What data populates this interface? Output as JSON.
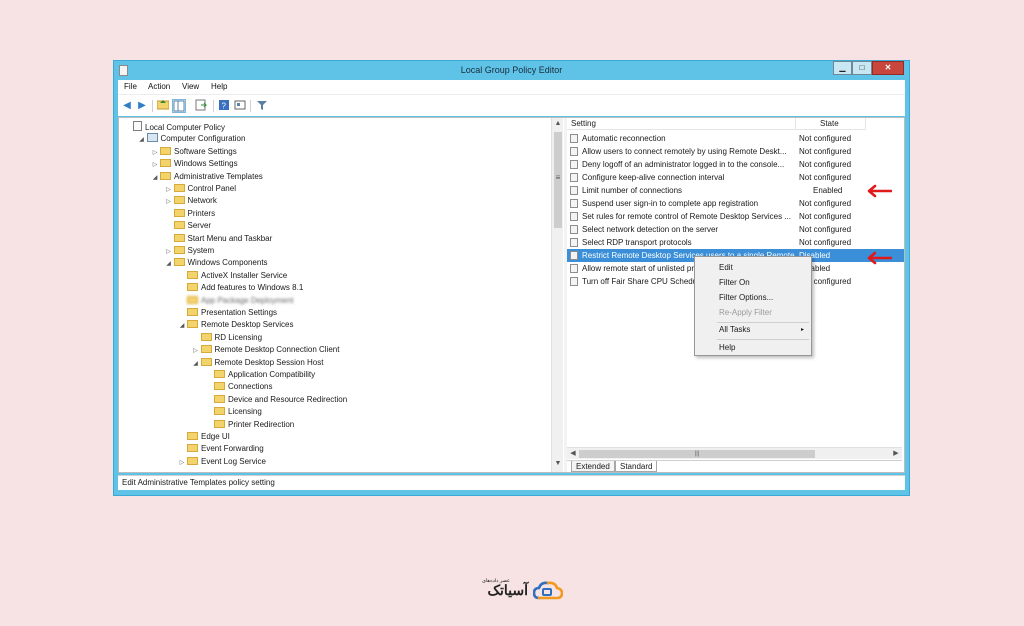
{
  "window": {
    "title": "Local Group Policy Editor",
    "controls": {
      "minimize": "▁",
      "maximize": "□",
      "close": "✕"
    }
  },
  "menu": [
    "File",
    "Action",
    "View",
    "Help"
  ],
  "toolbar": {
    "icons": [
      "back-arrow-icon",
      "forward-arrow-icon",
      "up-folder-icon",
      "show-hide-tree-icon",
      "export-list-icon",
      "help-icon",
      "properties-icon",
      "filter-icon"
    ]
  },
  "tree": [
    {
      "label": "Local Computer Policy",
      "icon": "doc",
      "expander": ""
    },
    {
      "label": "Computer Configuration",
      "icon": "pc",
      "expander": "◢"
    },
    {
      "label": "Software Settings",
      "icon": "folder",
      "expander": "▷"
    },
    {
      "label": "Windows Settings",
      "icon": "folder",
      "expander": "▷"
    },
    {
      "label": "Administrative Templates",
      "icon": "folder",
      "expander": "◢"
    },
    {
      "label": "Control Panel",
      "icon": "folder",
      "expander": "▷"
    },
    {
      "label": "Network",
      "icon": "folder",
      "expander": "▷"
    },
    {
      "label": "Printers",
      "icon": "folder",
      "expander": ""
    },
    {
      "label": "Server",
      "icon": "folder",
      "expander": ""
    },
    {
      "label": "Start Menu and Taskbar",
      "icon": "folder",
      "expander": ""
    },
    {
      "label": "System",
      "icon": "folder",
      "expander": "▷"
    },
    {
      "label": "Windows Components",
      "icon": "folder",
      "expander": "◢"
    },
    {
      "label": "ActiveX Installer Service",
      "icon": "folder",
      "expander": ""
    },
    {
      "label": "Add features to Windows 8.1",
      "icon": "folder",
      "expander": ""
    },
    {
      "label": "App Package Deployment",
      "icon": "folder",
      "expander": ""
    },
    {
      "label": "Presentation Settings",
      "icon": "folder",
      "expander": ""
    },
    {
      "label": "Remote Desktop Services",
      "icon": "folder",
      "expander": "◢"
    },
    {
      "label": "RD Licensing",
      "icon": "folder",
      "expander": ""
    },
    {
      "label": "Remote Desktop Connection Client",
      "icon": "folder",
      "expander": "▷"
    },
    {
      "label": "Remote Desktop Session Host",
      "icon": "folder",
      "expander": "◢"
    },
    {
      "label": "Application Compatibility",
      "icon": "folder",
      "expander": ""
    },
    {
      "label": "Connections",
      "icon": "folder",
      "expander": ""
    },
    {
      "label": "Device and Resource Redirection",
      "icon": "folder",
      "expander": ""
    },
    {
      "label": "Licensing",
      "icon": "folder",
      "expander": ""
    },
    {
      "label": "Printer Redirection",
      "icon": "folder",
      "expander": ""
    },
    {
      "label": "Edge UI",
      "icon": "folder",
      "expander": ""
    },
    {
      "label": "Event Forwarding",
      "icon": "folder",
      "expander": ""
    },
    {
      "label": "Event Log Service",
      "icon": "folder",
      "expander": "▷"
    }
  ],
  "list": {
    "headers": {
      "setting": "Setting",
      "state": "State"
    },
    "rows": [
      {
        "setting": "Automatic reconnection",
        "state": "Not configured"
      },
      {
        "setting": "Allow users to connect remotely by using Remote Deskt...",
        "state": "Not configured"
      },
      {
        "setting": "Deny logoff of an administrator logged in to the console...",
        "state": "Not configured"
      },
      {
        "setting": "Configure keep-alive connection interval",
        "state": "Not configured"
      },
      {
        "setting": "Limit number of connections",
        "state": "Enabled"
      },
      {
        "setting": "Suspend user sign-in to complete app registration",
        "state": "Not configured"
      },
      {
        "setting": "Set rules for remote control of Remote Desktop Services ...",
        "state": "Not configured"
      },
      {
        "setting": "Select network detection on the server",
        "state": "Not configured"
      },
      {
        "setting": "Select RDP transport protocols",
        "state": "Not configured"
      },
      {
        "setting": "Restrict Remote Desktop Services users to a single Remote...",
        "state": "Disabled",
        "selected": true
      },
      {
        "setting": "Allow remote start of unlisted programs",
        "state": "Disabled"
      },
      {
        "setting": "Turn off Fair Share CPU Scheduling",
        "state": "Not configured"
      }
    ]
  },
  "tabs": [
    "Extended",
    "Standard"
  ],
  "status": "Edit Administrative Templates policy setting",
  "context_menu": {
    "items": [
      "Edit",
      "Filter On",
      "Filter Options...",
      "Re-Apply Filter",
      "All Tasks",
      "Help"
    ],
    "disabled": [
      "Re-Apply Filter"
    ],
    "submenu_arrow": "▸"
  },
  "scroll": {
    "grip": "|||",
    "up": "▲",
    "down": "▼",
    "left": "◀",
    "right": "▶"
  },
  "logo": {
    "text": "آسیاتک",
    "subtitle": "عصر داده‌های"
  },
  "colors": {
    "window_frame": "#5fc3e8",
    "selection": "#3a8fd8",
    "annotation_arrow": "#e0191b",
    "background": "#f7e3e3"
  }
}
